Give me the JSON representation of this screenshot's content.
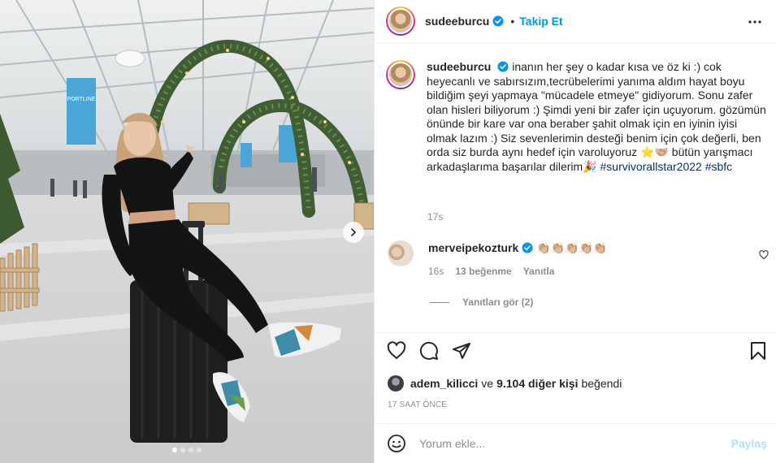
{
  "post": {
    "username": "sudeeburcu",
    "follow_sep": "•",
    "follow_label": "Takip Et",
    "caption": {
      "text": "inanın her şey o kadar kısa ve öz ki :) cok heyecanlı ve sabırsızım,tecrübelerimi yanıma aldım hayat boyu bildiğim şeyi yapmaya \"mücadele etmeye\" gidiyorum. Sonu zafer olan hisleri biliyorum :) Şimdi yeni bir zafer için uçuyorum. gözümün önünde bir kare var ona beraber şahit olmak için en iyinin iyisi olmak lazım :) Siz sevenlerimin desteği benim için çok değerli, ben orda siz burda aynı hedef için varoluyoruz ⭐🤝🏼 bütün yarışmacı arkadaşlarıma başarılar dilerim🎉",
      "hashtags": "#survivorallstar2022 #sbfc",
      "time": "17s"
    },
    "comments": [
      {
        "username": "merveipekozturk",
        "text": "👏🏼👏🏼👏🏼👏🏼👏🏼",
        "time": "16s",
        "likes": "13 beğenme",
        "reply_label": "Yanıtla",
        "replies_label": "Yanıtları gör (2)"
      }
    ],
    "likes": {
      "first_user": "adem_kilicci",
      "joiner": "ve",
      "others": "9.104 diğer kişi",
      "suffix": "beğendi"
    },
    "posted_ago": "17 SAAT ÖNCE",
    "comment_placeholder": "Yorum ekle...",
    "share_label": "Paylaş",
    "carousel": {
      "count": 4,
      "active_index": 0
    },
    "photo_signs": {
      "sign1": "PORTLINE",
      "sign2": "PORTLINE"
    }
  },
  "icons": {
    "header": [
      "verified-icon",
      "more-options-icon"
    ],
    "actions": [
      "heart-icon",
      "comment-icon",
      "share-icon",
      "save-icon"
    ],
    "misc": [
      "emoji-icon",
      "chevron-right-icon"
    ]
  },
  "colors": {
    "accent_blue": "#0095f6",
    "share_disabled": "#b2dffc",
    "muted_text": "#8e8e8e",
    "hashtag": "#00376b"
  }
}
